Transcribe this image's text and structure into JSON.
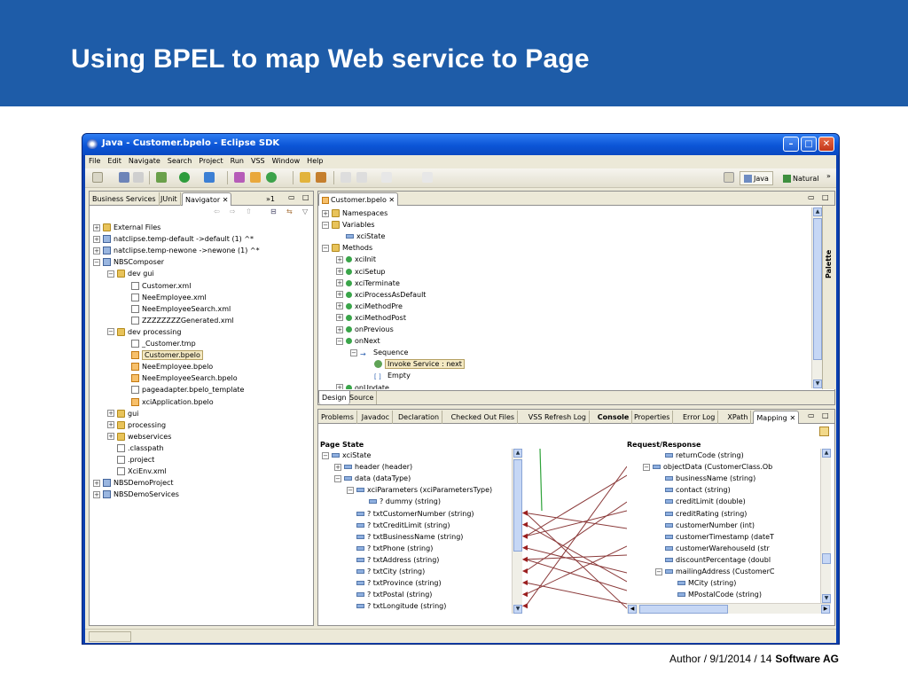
{
  "slide": {
    "title": "Using BPEL to map Web service to Page",
    "footer_left": "Author / 9/1/2014 / 14",
    "footer_brand": "Software AG"
  },
  "window": {
    "title": "Java - Customer.bpelo - Eclipse SDK"
  },
  "menu": [
    "File",
    "Edit",
    "Navigate",
    "Search",
    "Project",
    "Run",
    "VSS",
    "Window",
    "Help"
  ],
  "perspectives": {
    "java": "Java",
    "natural": "Natural",
    "more": "»"
  },
  "left_tabs": {
    "business": "Business Services",
    "junit": "JUnit",
    "navigator": "Navigator",
    "more": "»1"
  },
  "navigator": [
    {
      "label": "External Files",
      "depth": 0,
      "exp": "+",
      "icon": "folder"
    },
    {
      "label": "natclipse.temp-default ->default (1) ^*",
      "depth": 0,
      "exp": "+",
      "icon": "proj"
    },
    {
      "label": "natclipse.temp-newone ->newone (1) ^*",
      "depth": 0,
      "exp": "+",
      "icon": "proj"
    },
    {
      "label": "NBSComposer",
      "depth": 0,
      "exp": "-",
      "icon": "proj"
    },
    {
      "label": "dev gui",
      "depth": 1,
      "exp": "-",
      "icon": "folder"
    },
    {
      "label": "Customer.xml",
      "depth": 2,
      "exp": "",
      "icon": "file"
    },
    {
      "label": "NeeEmployee.xml",
      "depth": 2,
      "exp": "",
      "icon": "file"
    },
    {
      "label": "NeeEmployeeSearch.xml",
      "depth": 2,
      "exp": "",
      "icon": "file"
    },
    {
      "label": "ZZZZZZZZGenerated.xml",
      "depth": 2,
      "exp": "",
      "icon": "file"
    },
    {
      "label": "dev processing",
      "depth": 1,
      "exp": "-",
      "icon": "folder"
    },
    {
      "label": "_Customer.tmp",
      "depth": 2,
      "exp": "",
      "icon": "file"
    },
    {
      "label": "Customer.bpelo",
      "depth": 2,
      "exp": "",
      "icon": "bpelf",
      "selected": true
    },
    {
      "label": "NeeEmployee.bpelo",
      "depth": 2,
      "exp": "",
      "icon": "bpelf"
    },
    {
      "label": "NeeEmployeeSearch.bpelo",
      "depth": 2,
      "exp": "",
      "icon": "bpelf"
    },
    {
      "label": "pageadapter.bpelo_template",
      "depth": 2,
      "exp": "",
      "icon": "file"
    },
    {
      "label": "xciApplication.bpelo",
      "depth": 2,
      "exp": "",
      "icon": "bpelf"
    },
    {
      "label": "gui",
      "depth": 1,
      "exp": "+",
      "icon": "folder"
    },
    {
      "label": "processing",
      "depth": 1,
      "exp": "+",
      "icon": "folder"
    },
    {
      "label": "webservices",
      "depth": 1,
      "exp": "+",
      "icon": "folder"
    },
    {
      "label": ".classpath",
      "depth": 1,
      "exp": "",
      "icon": "file"
    },
    {
      "label": ".project",
      "depth": 1,
      "exp": "",
      "icon": "file"
    },
    {
      "label": "XciEnv.xml",
      "depth": 1,
      "exp": "",
      "icon": "file"
    },
    {
      "label": "NBSDemoProject",
      "depth": 0,
      "exp": "+",
      "icon": "proj"
    },
    {
      "label": "NBSDemoServices",
      "depth": 0,
      "exp": "+",
      "icon": "proj"
    }
  ],
  "editor": {
    "tab": "Customer.bpelo",
    "palette": "Palette",
    "bottom_tabs": [
      "Design",
      "Source"
    ],
    "tree": [
      {
        "label": "Namespaces",
        "depth": 0,
        "exp": "+",
        "icon": "folder"
      },
      {
        "label": "Variables",
        "depth": 0,
        "exp": "-",
        "icon": "folder"
      },
      {
        "label": "xciState",
        "depth": 1,
        "exp": "",
        "icon": "field"
      },
      {
        "label": "Methods",
        "depth": 0,
        "exp": "-",
        "icon": "folder"
      },
      {
        "label": "xciInit",
        "depth": 1,
        "exp": "+",
        "icon": "green"
      },
      {
        "label": "xciSetup",
        "depth": 1,
        "exp": "+",
        "icon": "green"
      },
      {
        "label": "xciTerminate",
        "depth": 1,
        "exp": "+",
        "icon": "green"
      },
      {
        "label": "xciProcessAsDefault",
        "depth": 1,
        "exp": "+",
        "icon": "green"
      },
      {
        "label": "xciMethodPre",
        "depth": 1,
        "exp": "+",
        "icon": "green"
      },
      {
        "label": "xciMethodPost",
        "depth": 1,
        "exp": "+",
        "icon": "green"
      },
      {
        "label": "onPrevious",
        "depth": 1,
        "exp": "+",
        "icon": "green"
      },
      {
        "label": "onNext",
        "depth": 1,
        "exp": "-",
        "icon": "green"
      },
      {
        "label": "Sequence",
        "depth": 2,
        "exp": "-",
        "icon": "seq"
      },
      {
        "label": "Invoke Service : next",
        "depth": 3,
        "exp": "",
        "icon": "invoke",
        "selected": true
      },
      {
        "label": "Empty",
        "depth": 3,
        "exp": "",
        "icon": "empty"
      },
      {
        "label": "onUpdate",
        "depth": 1,
        "exp": "+",
        "icon": "green"
      }
    ]
  },
  "bottom_tabs": [
    "Problems",
    "Javadoc",
    "Declaration",
    "Checked Out Files",
    "VSS Refresh Log",
    "Console",
    "Properties",
    "Error Log",
    "XPath",
    "Mapping"
  ],
  "mapping": {
    "left_header": "Page State",
    "right_header": "Request/Response",
    "left": [
      {
        "label": "xciState",
        "depth": 0,
        "exp": "-"
      },
      {
        "label": "header (header)",
        "depth": 1,
        "exp": "+"
      },
      {
        "label": "data (dataType)",
        "depth": 1,
        "exp": "-"
      },
      {
        "label": "xciParameters (xciParametersType)",
        "depth": 2,
        "exp": "-"
      },
      {
        "label": "? dummy (string)",
        "depth": 3,
        "exp": ""
      },
      {
        "label": "? txtCustomerNumber (string)",
        "depth": 2,
        "exp": ""
      },
      {
        "label": "? txtCreditLimit (string)",
        "depth": 2,
        "exp": ""
      },
      {
        "label": "? txtBusinessName (string)",
        "depth": 2,
        "exp": ""
      },
      {
        "label": "? txtPhone (string)",
        "depth": 2,
        "exp": ""
      },
      {
        "label": "? txtAddress (string)",
        "depth": 2,
        "exp": ""
      },
      {
        "label": "? txtCity (string)",
        "depth": 2,
        "exp": ""
      },
      {
        "label": "? txtProvince (string)",
        "depth": 2,
        "exp": ""
      },
      {
        "label": "? txtPostal (string)",
        "depth": 2,
        "exp": ""
      },
      {
        "label": "? txtLongitude (string)",
        "depth": 2,
        "exp": ""
      }
    ],
    "right": [
      {
        "label": "returnCode (string)",
        "depth": 2,
        "exp": ""
      },
      {
        "label": "objectData (CustomerClass.Ob",
        "depth": 1,
        "exp": "-"
      },
      {
        "label": "businessName (string)",
        "depth": 2,
        "exp": ""
      },
      {
        "label": "contact (string)",
        "depth": 2,
        "exp": ""
      },
      {
        "label": "creditLimit (double)",
        "depth": 2,
        "exp": ""
      },
      {
        "label": "creditRating (string)",
        "depth": 2,
        "exp": ""
      },
      {
        "label": "customerNumber (int)",
        "depth": 2,
        "exp": ""
      },
      {
        "label": "customerTimestamp (dateT",
        "depth": 2,
        "exp": ""
      },
      {
        "label": "customerWarehouseId (str",
        "depth": 2,
        "exp": ""
      },
      {
        "label": "discountPercentage (doubl",
        "depth": 2,
        "exp": ""
      },
      {
        "label": "mailingAddress (CustomerC",
        "depth": 2,
        "exp": "-"
      },
      {
        "label": "MCity (string)",
        "depth": 3,
        "exp": ""
      },
      {
        "label": "MPostalCode (string)",
        "depth": 3,
        "exp": ""
      }
    ]
  }
}
